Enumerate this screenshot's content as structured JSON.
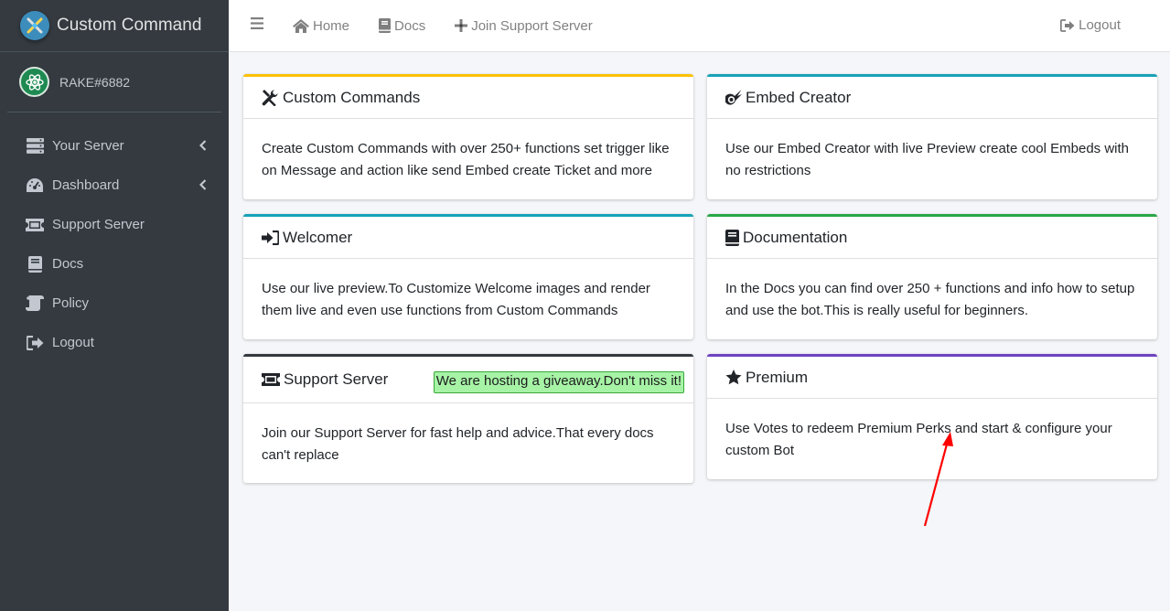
{
  "brand": {
    "title": "Custom Command"
  },
  "user": {
    "name": "RAKE#6882"
  },
  "sidebar": {
    "items": [
      {
        "label": "Your Server",
        "icon": "server-icon",
        "has_arrow": true
      },
      {
        "label": "Dashboard",
        "icon": "tachometer-icon",
        "has_arrow": true
      },
      {
        "label": "Support Server",
        "icon": "ticket-icon",
        "has_arrow": false
      },
      {
        "label": "Docs",
        "icon": "book-icon",
        "has_arrow": false
      },
      {
        "label": "Policy",
        "icon": "scroll-icon",
        "has_arrow": false
      },
      {
        "label": "Logout",
        "icon": "sign-out-icon",
        "has_arrow": false
      }
    ]
  },
  "topbar": {
    "home": "Home",
    "docs": "Docs",
    "join": "Join Support Server",
    "logout": "Logout"
  },
  "cards": {
    "custom_commands": {
      "title": "Custom Commands",
      "body": "Create Custom Commands with over 250+ functions set trigger like on Message and action like send Embed create Ticket and more",
      "accent": "#ffc107"
    },
    "embed_creator": {
      "title": "Embed Creator",
      "body": "Use our Embed Creator with live Preview create cool Embeds with no restrictions",
      "accent": "#17a2b8"
    },
    "welcomer": {
      "title": "Welcomer",
      "body": "Use our live preview.To Customize Welcome images and render them live and even use functions from Custom Commands",
      "accent": "#17a2b8"
    },
    "documentation": {
      "title": "Documentation",
      "body": "In the Docs you can find over 250 + functions and info how to setup and use the bot.This is really useful for beginners.",
      "accent": "#28a745"
    },
    "support_server": {
      "title": "Support Server",
      "badge": "We are hosting a giveaway.Don't miss it!",
      "body": "Join our Support Server for fast help and advice.That every docs can't replace",
      "accent": "#343a40"
    },
    "premium": {
      "title": "Premium",
      "body": "Use Votes to redeem Premium Perks and start & configure your custom Bot",
      "accent": "#6f42c1"
    }
  },
  "colors": {
    "sidebar_bg": "#343a40",
    "annotation_arrow": "#ff0000",
    "giveaway_badge_bg": "#a6f3a6"
  }
}
